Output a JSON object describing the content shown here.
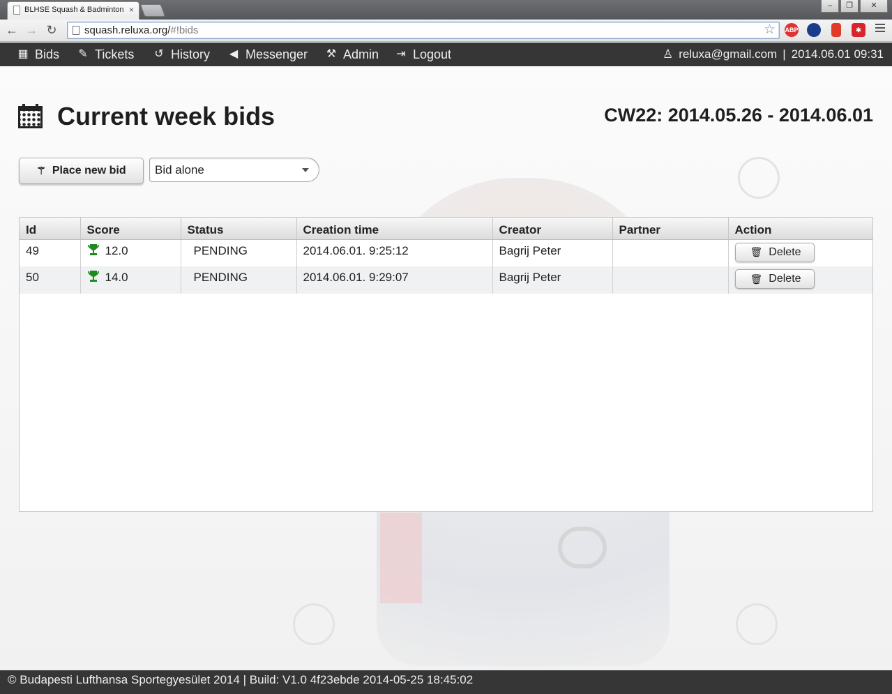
{
  "browser": {
    "tab_title": "BLHSE Squash & Badminton",
    "url_host": "squash.reluxa.org/",
    "url_path": "#!bids",
    "tab_close": "×",
    "ext_abp": "ABP"
  },
  "nav": {
    "items": [
      {
        "label": "Bids",
        "icon": "calendar-icon"
      },
      {
        "label": "Tickets",
        "icon": "ticket-icon"
      },
      {
        "label": "History",
        "icon": "history-icon"
      },
      {
        "label": "Messenger",
        "icon": "megaphone-icon"
      },
      {
        "label": "Admin",
        "icon": "wrench-icon"
      },
      {
        "label": "Logout",
        "icon": "logout-icon"
      }
    ],
    "user_email": "reluxa@gmail.com",
    "separator": "|",
    "datetime": "2014.06.01 09:31"
  },
  "page": {
    "title": "Current week bids",
    "week_range": "CW22: 2014.05.26 - 2014.06.01",
    "place_bid_label": "Place new bid",
    "bid_mode_selected": "Bid alone"
  },
  "table": {
    "columns": [
      "Id",
      "Score",
      "Status",
      "Creation time",
      "Creator",
      "Partner",
      "Action"
    ],
    "rows": [
      {
        "id": "49",
        "score": "12.0",
        "status": "PENDING",
        "created": "2014.06.01. 9:25:12",
        "creator": "Bagrij Peter",
        "partner": "",
        "action": "Delete"
      },
      {
        "id": "50",
        "score": "14.0",
        "status": "PENDING",
        "created": "2014.06.01. 9:29:07",
        "creator": "Bagrij Peter",
        "partner": "",
        "action": "Delete"
      }
    ]
  },
  "footer": {
    "text": "© Budapesti Lufthansa Sportegyesület 2014 | Build: V1.0 4f23ebde 2014-05-25 18:45:02"
  },
  "colors": {
    "nav_bg": "#363636",
    "trophy": "#1f8a1f",
    "alt_row": "#f0f1f2"
  }
}
